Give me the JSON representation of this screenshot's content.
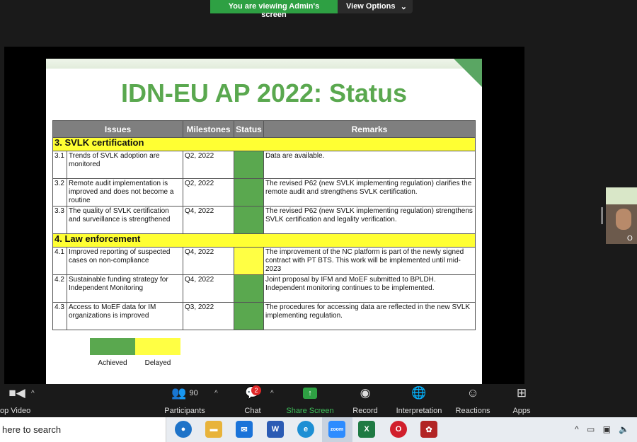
{
  "banner": {
    "message": "You are viewing Admin's screen",
    "view_options": "View Options",
    "caret": "⌄"
  },
  "slide": {
    "title": "IDN-EU AP 2022: Status",
    "headers": {
      "issues": "Issues",
      "milestones": "Milestones",
      "status": "Status",
      "remarks": "Remarks"
    },
    "sections": [
      {
        "title": "3. SVLK certification",
        "rows": [
          {
            "num": "3.1",
            "issue": "Trends of SVLK adoption are monitored",
            "milestone": "Q2, 2022",
            "status": "achieved",
            "remark": "Data are available."
          },
          {
            "num": "3.2",
            "issue": "Remote audit implementation is improved and does not become a routine",
            "milestone": "Q2, 2022",
            "status": "achieved",
            "remark": "The revised P62 (new SVLK implementing regulation) clarifies the remote audit and strengthens SVLK certification."
          },
          {
            "num": "3.3",
            "issue": "The quality of SVLK certification and surveillance is strengthened",
            "milestone": "Q4, 2022",
            "status": "achieved",
            "remark": "The revised P62 (new SVLK implementing regulation) strengthens SVLK certification and legality verification."
          }
        ]
      },
      {
        "title": "4. Law enforcement",
        "rows": [
          {
            "num": "4.1",
            "issue": "Improved reporting of suspected cases on non-compliance",
            "milestone": "Q4, 2022",
            "status": "delayed",
            "remark": "The improvement of the NC platform is part of the newly signed contract with PT BTS. This work will be implemented until mid-2023"
          },
          {
            "num": "4.2",
            "issue": "Sustainable funding strategy for Independent Monitoring",
            "milestone": "Q4, 2022",
            "status": "achieved",
            "remark": "Joint proposal by IFM and MoEF submitted to BPLDH. Independent monitoring continues to be implemented."
          },
          {
            "num": "4.3",
            "issue": "Access to MoEF data for IM organizations is improved",
            "milestone": "Q3, 2022",
            "status": "achieved",
            "remark": "The procedures for accessing data are reflected in the new SVLK implementing regulation."
          }
        ]
      }
    ],
    "legend": {
      "achieved": "Achieved",
      "delayed": "Delayed"
    }
  },
  "colors": {
    "achieved": "#5aa84f",
    "delayed": "#ffff44",
    "section": "#ffff33",
    "header": "#7f7f7f",
    "title": "#5aa84f"
  },
  "video_thumb": {
    "name_initial": "O"
  },
  "toolbar": {
    "video": "op Video",
    "participants": "Participants",
    "participants_count": "90",
    "chat": "Chat",
    "chat_badge": "2",
    "share": "Share Screen",
    "record": "Record",
    "interpretation": "Interpretation",
    "reactions": "Reactions",
    "apps": "Apps"
  },
  "taskbar": {
    "search": "here to search",
    "apps": [
      "chrome-icon",
      "file-explorer-icon",
      "mail-icon",
      "word-icon",
      "edge-icon",
      "zoom-icon",
      "excel-icon",
      "opera-icon",
      "app-icon"
    ],
    "zoom_label": "zoom",
    "word_label": "W",
    "excel_label": "X"
  }
}
